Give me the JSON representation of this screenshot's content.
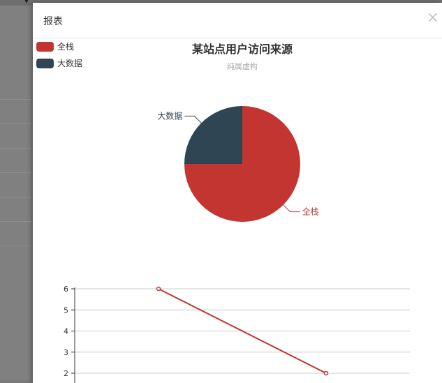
{
  "modal": {
    "title": "报表",
    "close_label": "×"
  },
  "colors": {
    "series_red": "#c23531",
    "series_dark": "#2f4554",
    "grid": "#cccccc",
    "axis": "#333333",
    "subtitle": "#aaaaaa"
  },
  "chart_data": [
    {
      "type": "pie",
      "title": "某站点用户访问来源",
      "subtitle": "纯属虚构",
      "legend": [
        "全栈",
        "大数据"
      ],
      "legend_position": "top-left",
      "slices": [
        {
          "name": "全栈",
          "value": 3
        },
        {
          "name": "大数据",
          "value": 1
        }
      ]
    },
    {
      "type": "line",
      "series": [
        {
          "values": [
            6,
            2
          ]
        }
      ],
      "y_ticks": [
        2,
        3,
        4,
        5,
        6
      ],
      "grid": true
    }
  ]
}
